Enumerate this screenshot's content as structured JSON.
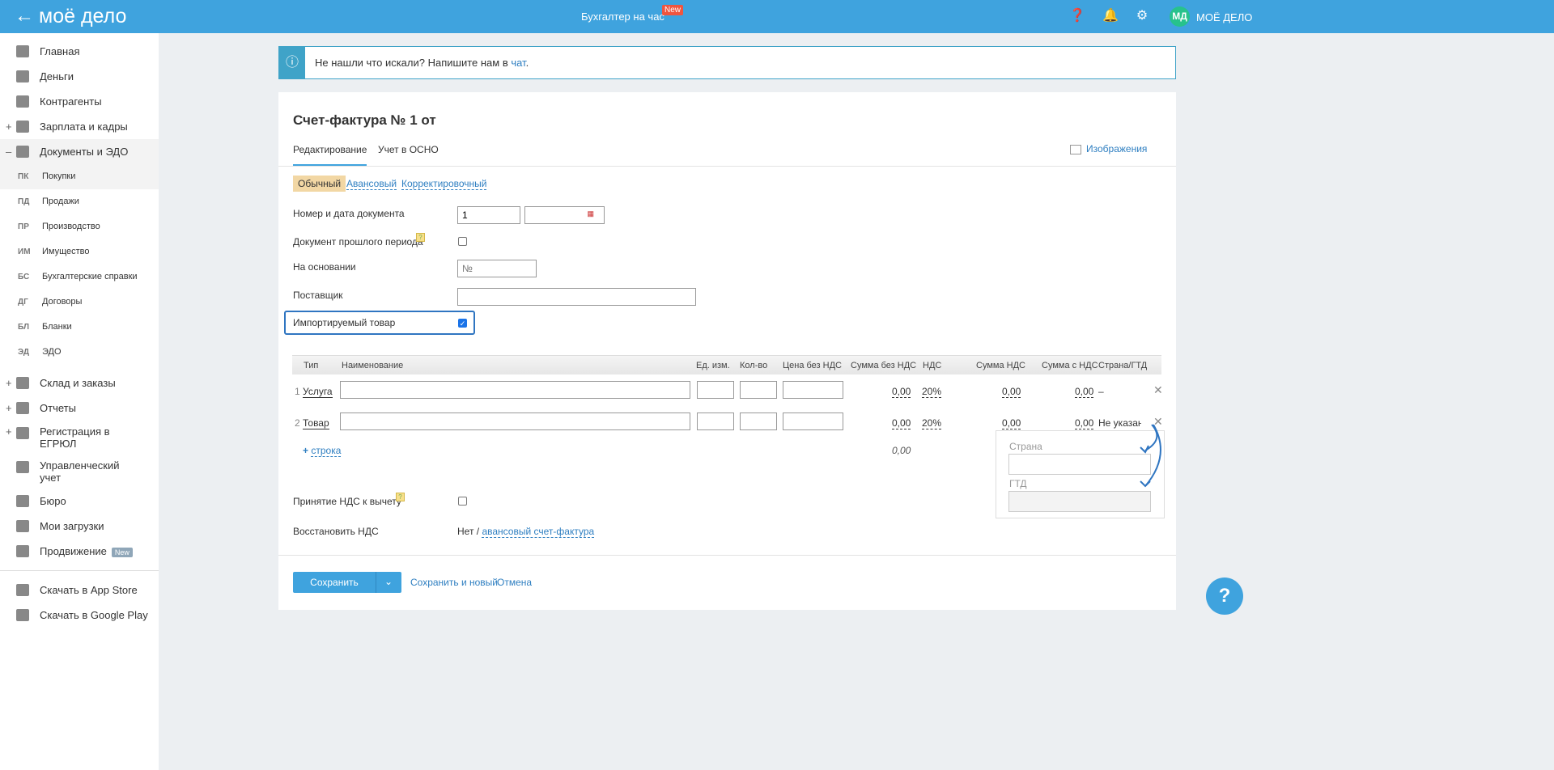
{
  "header": {
    "logo": "моё дело",
    "center_link": "Бухгалтер на час",
    "new_badge": "New",
    "user_initials": "МД",
    "user_name": "МОЁ ДЕЛО",
    "icons": [
      "question-icon",
      "bell-icon",
      "gear-icon"
    ]
  },
  "sidebar": {
    "items_top": [
      {
        "label": "Главная",
        "pm": ""
      },
      {
        "label": "Деньги",
        "pm": ""
      },
      {
        "label": "Контрагенты",
        "pm": ""
      },
      {
        "label": "Зарплата и кадры",
        "pm": "+"
      },
      {
        "label": "Документы и ЭДО",
        "pm": "–"
      }
    ],
    "sub": [
      {
        "ab": "ПК",
        "label": "Покупки"
      },
      {
        "ab": "ПД",
        "label": "Продажи"
      },
      {
        "ab": "ПР",
        "label": "Производство"
      },
      {
        "ab": "ИМ",
        "label": "Имущество"
      },
      {
        "ab": "БС",
        "label": "Бухгалтерские справки"
      },
      {
        "ab": "ДГ",
        "label": "Договоры"
      },
      {
        "ab": "БЛ",
        "label": "Бланки"
      },
      {
        "ab": "ЭД",
        "label": "ЭДО"
      }
    ],
    "items_bottom": [
      {
        "label": "Склад и заказы",
        "pm": "+"
      },
      {
        "label": "Отчеты",
        "pm": "+"
      },
      {
        "label": "Регистрация в ЕГРЮЛ",
        "pm": "+"
      },
      {
        "label": "Управленческий учет",
        "pm": ""
      },
      {
        "label": "Бюро",
        "pm": ""
      },
      {
        "label": "Мои загрузки",
        "pm": ""
      },
      {
        "label": "Продвижение",
        "pm": "",
        "badge": "New"
      }
    ],
    "stores": [
      "Скачать в App Store",
      "Скачать в Google Play"
    ]
  },
  "info": {
    "text": "Не нашли что искали? Напишите нам в ",
    "link": "чат",
    "dot": "."
  },
  "doc": {
    "title": "Счет-фактура № 1 от",
    "tabs": [
      "Редактирование",
      "Учет в ОСНО"
    ],
    "images": "Изображения",
    "types": [
      "Обычный",
      "Авансовый",
      "Корректировочный"
    ],
    "labels": {
      "num_date": "Номер и дата документа",
      "prev_period": "Документ прошлого периода",
      "basis": "На основании",
      "supplier": "Поставщик",
      "imported": "Импортируемый товар",
      "vat_deduct": "Принятие НДС к вычету",
      "restore_vat": "Восстановить НДС"
    },
    "num_value": "1",
    "basis_placeholder": "№",
    "imported_checked": true,
    "restore_value": "Нет / ",
    "restore_link": "авансовый счет-фактура"
  },
  "table": {
    "headers": [
      "Тип",
      "Наименование",
      "Ед. изм.",
      "Кол-во",
      "Цена без НДС",
      "Сумма без НДС",
      "НДС",
      "Сумма НДС",
      "Сумма с НДС",
      "Страна/ГТД"
    ],
    "rows": [
      {
        "n": "1",
        "type": "Услуга",
        "sum": "0,00",
        "vat": "20%",
        "vat_sum": "0,00",
        "total": "0,00",
        "country": "–"
      },
      {
        "n": "2",
        "type": "Товар",
        "sum": "0,00",
        "vat": "20%",
        "vat_sum": "0,00",
        "total": "0,00",
        "country": "Не указано"
      }
    ],
    "add_row": "строка",
    "total": "0,00"
  },
  "popup": {
    "country": "Страна",
    "gtd": "ГТД"
  },
  "footer": {
    "save": "Сохранить",
    "save_new": "Сохранить и новый",
    "cancel": "Отмена"
  },
  "help": "?"
}
